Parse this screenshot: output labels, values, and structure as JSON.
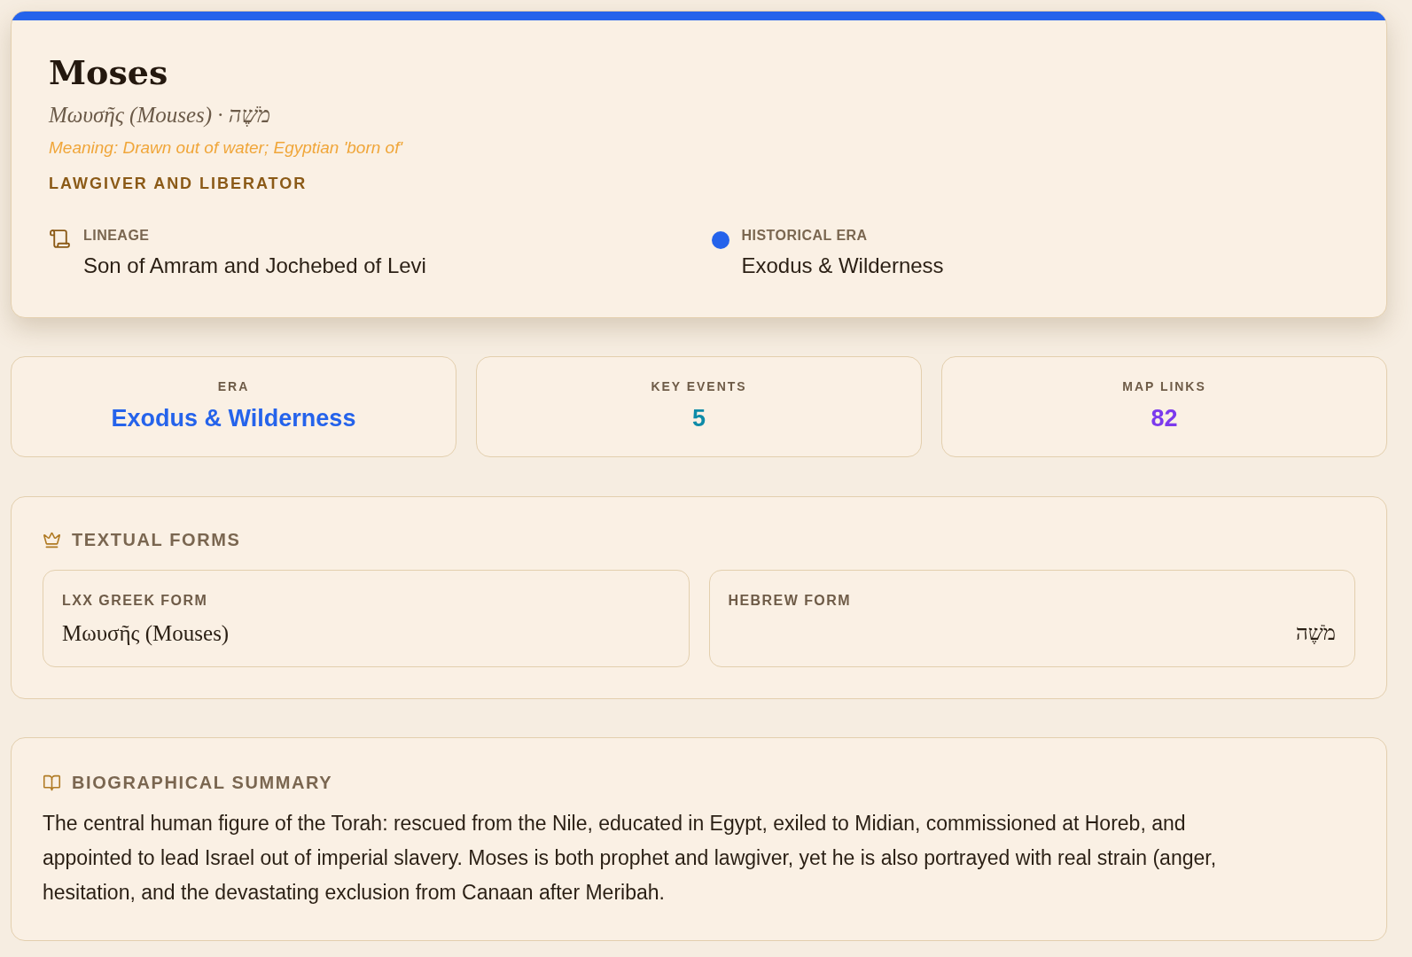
{
  "header": {
    "name": "Moses",
    "subtitle": "Μωυσῆς (Mouses) · מֹשֶׁה",
    "meaning": "Meaning: Drawn out of water; Egyptian 'born of'",
    "role": "LAWGIVER AND LIBERATOR",
    "details": [
      {
        "kind": "lineage",
        "label": "LINEAGE",
        "value": "Son of Amram and Jochebed of Levi"
      },
      {
        "kind": "era",
        "label": "HISTORICAL ERA",
        "value": "Exodus & Wilderness",
        "color": "#2563eb"
      }
    ]
  },
  "stats": [
    {
      "label": "ERA",
      "value": "Exodus & Wilderness",
      "color": "#2563eb"
    },
    {
      "label": "KEY EVENTS",
      "value": "5",
      "color": "#0e8ba8"
    },
    {
      "label": "MAP LINKS",
      "value": "82",
      "color": "#7c3aed"
    }
  ],
  "textual_forms": {
    "title": "TEXTUAL FORMS",
    "forms": [
      {
        "kind": "greek",
        "label": "LXX GREEK FORM",
        "value": "Μωυσῆς (Mouses)"
      },
      {
        "kind": "hebrew",
        "label": "HEBREW FORM",
        "value": "מֹשֶׁה"
      }
    ]
  },
  "summary": {
    "title": "BIOGRAPHICAL SUMMARY",
    "text": "The central human figure of the Torah: rescued from the Nile, educated in Egypt, exiled to Midian, commissioned at Horeb, and appointed to lead Israel out of imperial slavery. Moses is both prophet and lawgiver, yet he is also portrayed with real strain (anger, hesitation, and the devastating exclusion from Canaan after Meribah."
  }
}
